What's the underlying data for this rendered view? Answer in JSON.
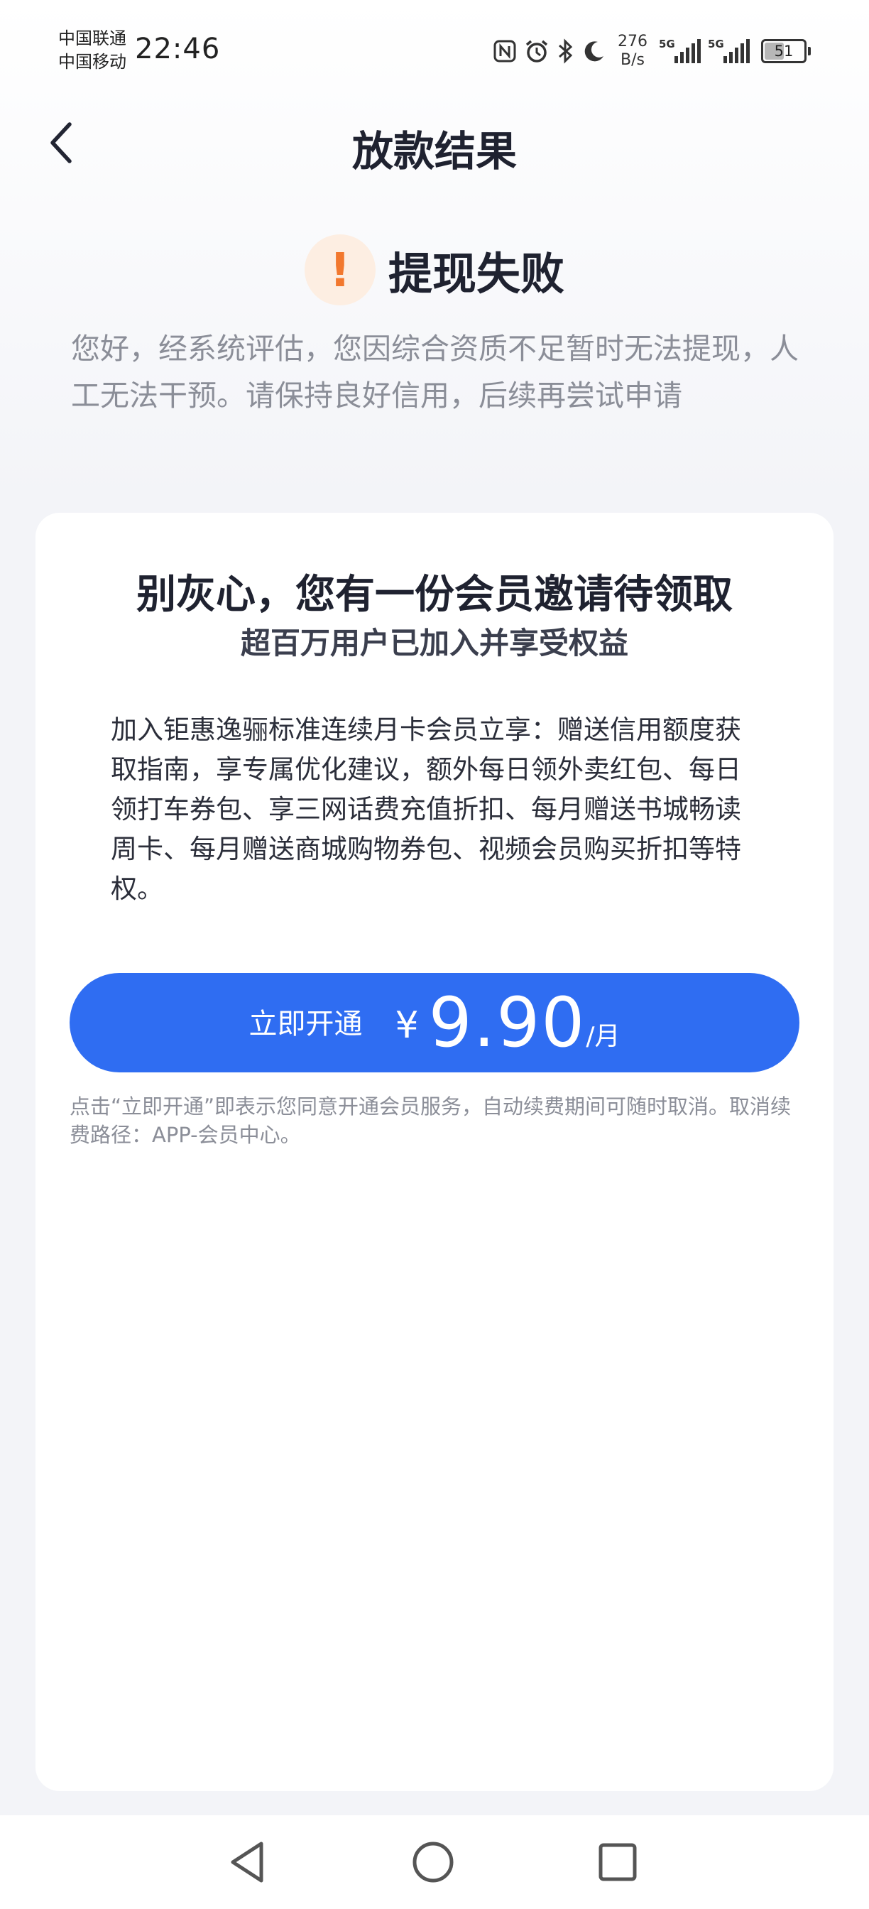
{
  "status_bar": {
    "carrier_1": "中国联通",
    "carrier_2": "中国移动",
    "time": "22:46",
    "net_speed_value": "276",
    "net_speed_unit": "B/s",
    "signal_1_label": "5G",
    "signal_2_label": "5G",
    "battery_level": "51",
    "icons": [
      "nfc-icon",
      "alarm-icon",
      "bluetooth-icon",
      "moon-icon"
    ]
  },
  "nav": {
    "title": "放款结果"
  },
  "result": {
    "title": "提现失败",
    "icon_glyph": "!",
    "description": "您好，经系统评估，您因综合资质不足暂时无法提现，人工无法干预。请保持良好信用，后续再尝试申请"
  },
  "card": {
    "title": "别灰心，您有一份会员邀请待领取",
    "subtitle": "超百万用户已加入并享受权益",
    "body": "加入钜惠逸骊标准连续月卡会员立享：赠送信用额度获取指南，享专属优化建议，额外每日领外卖红包、每日领打车券包、享三网话费充值折扣、每月赠送书城畅读周卡、每月赠送商城购物券包、视频会员购买折扣等特权。",
    "button": {
      "label": "立即开通",
      "currency": "¥",
      "price": "9.90",
      "unit": "/月"
    },
    "agreement": "点击“立即开通”即表示您同意开通会员服务，自动续费期间可随时取消。取消续费路径：APP-会员中心。"
  },
  "colors": {
    "primary": "#2f6df2",
    "warning": "#f2782e",
    "warning_bg": "#fdeee2",
    "background": "#f3f4f8"
  }
}
